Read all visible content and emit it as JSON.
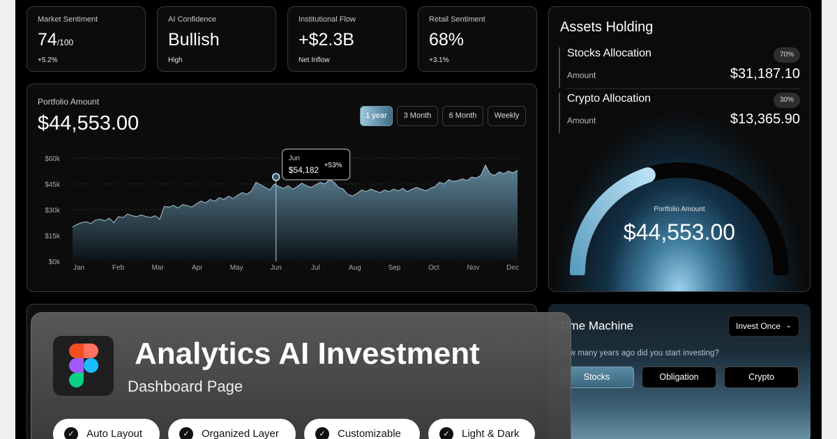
{
  "stats": [
    {
      "label": "Market Sentiment",
      "value": "74",
      "unit": "/100",
      "sub": "+5.2%"
    },
    {
      "label": "AI Confidence",
      "value": "Bullish",
      "unit": "",
      "sub": "High"
    },
    {
      "label": "Institutional Flow",
      "value": "+$2.3B",
      "unit": "",
      "sub": "Net Inflow"
    },
    {
      "label": "Retail Sentiment",
      "value": "68%",
      "unit": "",
      "sub": "+3.1%"
    }
  ],
  "portfolio": {
    "label": "Portfolio Amount",
    "value": "$44,553.00",
    "ranges": [
      "1 year",
      "3 Month",
      "6 Month",
      "Weekly"
    ],
    "active_range": "1 year"
  },
  "chart_data": {
    "type": "area",
    "x": [
      "Jan",
      "Feb",
      "Mar",
      "Apr",
      "May",
      "Jun",
      "Jul",
      "Aug",
      "Sep",
      "Oct",
      "Nov",
      "Dec"
    ],
    "y_ticks": [
      "$60k",
      "$45k",
      "$30k",
      "$15k",
      "$0k"
    ],
    "ylim": [
      0,
      60000
    ],
    "series": [
      {
        "values": [
          20000,
          21500,
          22500,
          23000,
          22000,
          24000,
          24500,
          23500,
          25000,
          22500,
          26000,
          25500,
          27500,
          26500,
          26000,
          27000,
          26000,
          25500,
          26500,
          24500,
          32000,
          31500,
          32500,
          31000,
          33000,
          32500,
          31500,
          33500,
          35000,
          34000,
          36000,
          35000,
          37000,
          36000,
          38000,
          36500,
          38500,
          40000,
          39000,
          41000,
          46000,
          44500,
          43000,
          41500,
          45000,
          43500,
          42500,
          44000,
          42000,
          43500,
          45500,
          44000,
          43000,
          44500,
          46000,
          45000,
          47500,
          46000,
          43000,
          42000,
          39000,
          38000,
          39500,
          41500,
          40500,
          42000,
          41000,
          40000,
          41500,
          40500,
          42000,
          41000,
          42500,
          40500,
          42000,
          43000,
          42000,
          41000,
          42500,
          43500,
          46000,
          45000,
          47500,
          46500,
          47000,
          48000,
          47000,
          49000,
          48500,
          50000,
          56000,
          51000,
          50000,
          52000,
          51000,
          52500,
          51500,
          53000
        ]
      }
    ],
    "grid": true,
    "tooltip": {
      "month": "Jun",
      "value": "$54,182",
      "change": "+53%"
    }
  },
  "assets": {
    "title": "Assets Holding",
    "items": [
      {
        "name": "Stocks Allocation",
        "pct": "70%",
        "amount_label": "Amount",
        "amount": "$31,187.10"
      },
      {
        "name": "Crypto Allocation",
        "pct": "30%",
        "amount_label": "Amount",
        "amount": "$13,365.90"
      }
    ],
    "gauge_label": "Portfolio Amount",
    "gauge_value": "$44,553.00",
    "gauge_fraction": 0.4
  },
  "time_machine": {
    "title": "Time Machine",
    "select_value": "Invest Once",
    "question": "How many years ago did you start investing?",
    "tabs": [
      "Stocks",
      "Obligation",
      "Crypto"
    ],
    "active_tab": "Stocks"
  },
  "promo": {
    "title": "Analytics AI Investment",
    "subtitle": "Dashboard Page",
    "features": [
      "Auto Layout",
      "Organized Layer",
      "Customizable",
      "Light & Dark"
    ]
  },
  "colors": {
    "accent": "#8fc3dc",
    "area_top": "#5f8598",
    "area_bottom": "#0b1217",
    "card_border": "#3a3a3a"
  }
}
